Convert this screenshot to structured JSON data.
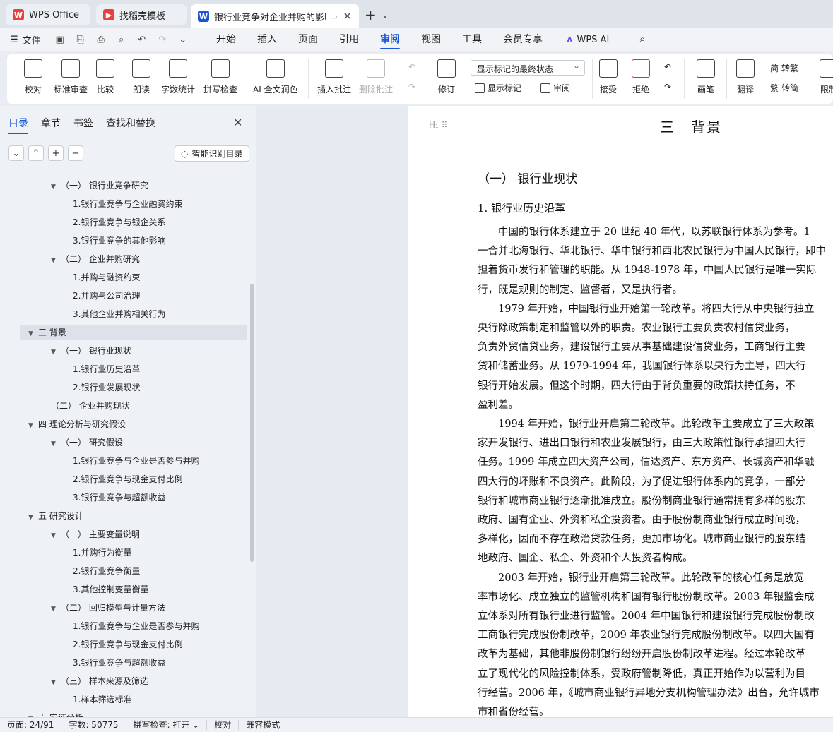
{
  "tabs": [
    {
      "label": "WPS Office",
      "logo": "W",
      "color": "#e8413c"
    },
    {
      "label": "找稻壳模板",
      "logo": "▶",
      "color": "#e8413c"
    },
    {
      "label": "银行业竞争对企业并购的影响",
      "logo": "W",
      "color": "#1a56d6"
    }
  ],
  "menu": {
    "file": "文件",
    "tabs": [
      "开始",
      "插入",
      "页面",
      "引用",
      "审阅",
      "视图",
      "工具",
      "会员专享"
    ],
    "active": "审阅",
    "ai": "WPS AI"
  },
  "ribbon": {
    "proof": "校对",
    "std_review": "标准审查",
    "compare": "比较",
    "read_aloud": "朗读",
    "word_count": "字数统计",
    "spell_check": "拼写检查",
    "ai_polish": "AI 全文润色",
    "insert_comment": "插入批注",
    "delete_comment": "删除批注",
    "track": "修订",
    "markup_dropdown": "显示标记的最终状态",
    "show_markup": "显示标记",
    "review": "审阅",
    "accept": "接受",
    "reject": "拒绝",
    "pen": "画笔",
    "translate": "翻译",
    "to_trad": "简 转繁",
    "to_simp": "繁 转简",
    "restrict": "限制"
  },
  "nav": {
    "tabs": [
      "目录",
      "章节",
      "书签",
      "查找和替换"
    ],
    "active": "目录",
    "smart_toc": "智能识别目录",
    "toc": [
      {
        "text": "（一） 银行业竞争研究",
        "level": 2,
        "arrow": true
      },
      {
        "text": "1.银行业竞争与企业融资约束",
        "level": 3
      },
      {
        "text": "2.银行业竞争与银企关系",
        "level": 3
      },
      {
        "text": "3.银行业竞争的其他影响",
        "level": 3
      },
      {
        "text": "（二） 企业并购研究",
        "level": 2,
        "arrow": true
      },
      {
        "text": "1.并购与融资约束",
        "level": 3
      },
      {
        "text": "2.并购与公司治理",
        "level": 3
      },
      {
        "text": "3.其他企业并购相关行为",
        "level": 3
      },
      {
        "text": "三 背景",
        "level": 1,
        "arrow": true,
        "selected": true
      },
      {
        "text": "（一） 银行业现状",
        "level": 2,
        "arrow": true
      },
      {
        "text": "1.银行业历史沿革",
        "level": 3
      },
      {
        "text": "2.银行业发展现状",
        "level": 3
      },
      {
        "text": "（二） 企业并购现状",
        "level": 2
      },
      {
        "text": "四 理论分析与研究假设",
        "level": 1,
        "arrow": true
      },
      {
        "text": "（一） 研究假设",
        "level": 2,
        "arrow": true
      },
      {
        "text": "1.银行业竞争与企业是否参与并购",
        "level": 3
      },
      {
        "text": "2.银行业竞争与现金支付比例",
        "level": 3
      },
      {
        "text": "3.银行业竞争与超额收益",
        "level": 3
      },
      {
        "text": "五 研究设计",
        "level": 1,
        "arrow": true
      },
      {
        "text": "（一） 主要变量说明",
        "level": 2,
        "arrow": true
      },
      {
        "text": "1.并购行为衡量",
        "level": 3
      },
      {
        "text": "2.银行业竞争衡量",
        "level": 3
      },
      {
        "text": "3.其他控制变量衡量",
        "level": 3
      },
      {
        "text": "（二） 回归模型与计量方法",
        "level": 2,
        "arrow": true
      },
      {
        "text": "1.银行业竞争与企业是否参与并购",
        "level": 3
      },
      {
        "text": "2.银行业竞争与现金支付比例",
        "level": 3
      },
      {
        "text": "3.银行业竞争与超额收益",
        "level": 3
      },
      {
        "text": "（三） 样本来源及筛选",
        "level": 2,
        "arrow": true
      },
      {
        "text": "1.样本筛选标准",
        "level": 3
      },
      {
        "text": "六 实证分析",
        "level": 1,
        "arrow": true
      }
    ]
  },
  "doc": {
    "heading1": "三　背景",
    "heading2": "（一）  银行业现状",
    "heading3": "1.  银行业历史沿革",
    "paragraphs": [
      [
        "　　中国的银行体系建立于 20 世纪 40 年代，以苏联银行体系为参考。1",
        "一合并北海银行、华北银行、华中银行和西北农民银行为中国人民银行，即中",
        "担着货币发行和管理的职能。从 1948-1978 年，中国人民银行是唯一实际",
        "行，既是规则的制定、监督者，又是执行者。"
      ],
      [
        "　　1979 年开始，中国银行业开始第一轮改革。将四大行从中央银行独立",
        "央行除政策制定和监管以外的职责。农业银行主要负责农村信贷业务，",
        "负责外贸信贷业务，建设银行主要从事基础建设信贷业务，工商银行主要",
        "贷和储蓄业务。从 1979-1994 年，我国银行体系以央行为主导，四大行",
        "银行开始发展。但这个时期，四大行由于背负重要的政策扶持任务，不",
        "盈利差。"
      ],
      [
        "　　1994 年开始，银行业开启第二轮改革。此轮改革主要成立了三大政策",
        "家开发银行、进出口银行和农业发展银行，由三大政策性银行承担四大行",
        "任务。1999 年成立四大资产公司，信达资产、东方资产、长城资产和华融",
        "四大行的坏账和不良资产。此阶段，为了促进银行体系内的竞争，一部分",
        "银行和城市商业银行逐渐批准成立。股份制商业银行通常拥有多样的股东",
        "政府、国有企业、外资和私企投资者。由于股份制商业银行成立时间晚，",
        "多样化，因而不存在政治贷款任务，更加市场化。城市商业银行的股东结",
        "地政府、国企、私企、外资和个人投资者构成。"
      ],
      [
        "　　2003 年开始，银行业开启第三轮改革。此轮改革的核心任务是放宽",
        "率市场化、成立独立的监管机构和国有银行股份制改革。2003 年银监会成",
        "立体系对所有银行业进行监管。2004 年中国银行和建设银行完成股份制改",
        "工商银行完成股份制改革，2009 年农业银行完成股份制改革。以四大国有",
        "改革为基础，其他非股份制银行纷纷开启股份制改革进程。经过本轮改革",
        "立了现代化的风险控制体系，受政府管制降低，真正开始作为以营利为目",
        "行经营。2006 年，《城市商业银行异地分支机构管理办法》出台，允许城市",
        "市和省份经营。"
      ]
    ]
  },
  "status": {
    "page": "页面: 24/91",
    "words": "字数: 50775",
    "spell": "拼写检查: 打开",
    "proof": "校对",
    "compat": "兼容模式"
  }
}
